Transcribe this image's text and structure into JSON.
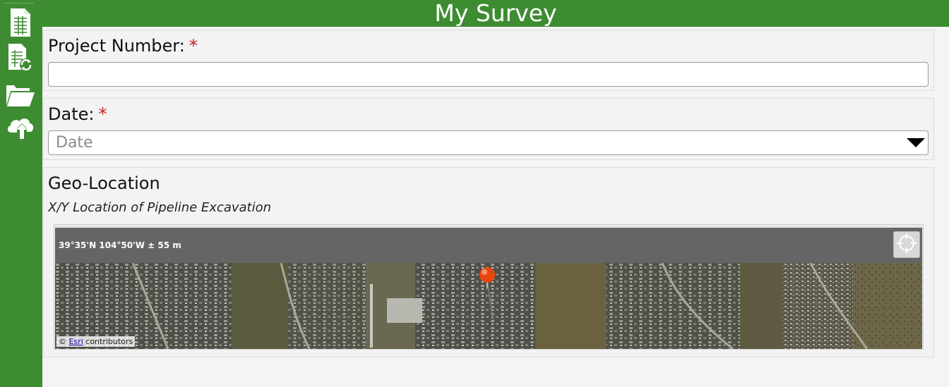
{
  "sidebar": {
    "items": [
      {
        "icon": "spreadsheet-icon"
      },
      {
        "icon": "refresh-sheet-icon"
      },
      {
        "icon": "folder-icon"
      },
      {
        "icon": "cloud-upload-icon"
      }
    ]
  },
  "header": {
    "title": "My Survey"
  },
  "fields": {
    "project_number": {
      "label": "Project Number:",
      "required_mark": "*",
      "value": ""
    },
    "date": {
      "label": "Date:",
      "required_mark": "*",
      "placeholder": "Date"
    },
    "geo": {
      "label": "Geo-Location",
      "hint": "X/Y Location of Pipeline Excavation",
      "coords": "39°35'N  104°50'W  ± 55 m",
      "attribution": {
        "prefix": "©",
        "link": "Esri",
        "suffix": "contributors"
      }
    }
  },
  "colors": {
    "brand_green": "#3d8c32",
    "required_red": "#c8201e",
    "marker": "#e8450f"
  }
}
